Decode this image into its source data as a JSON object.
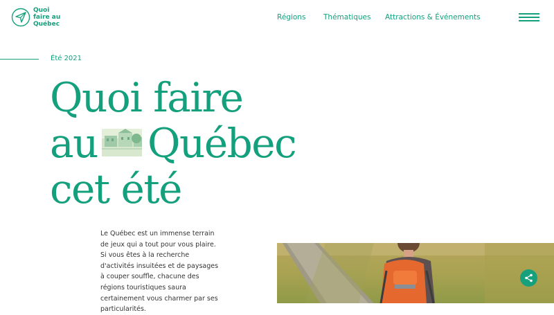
{
  "brand": {
    "lines": [
      "Quoi",
      "faire au",
      "Québec"
    ]
  },
  "nav": {
    "items": [
      "Régions",
      "Thématiques",
      "Attractions & Événements"
    ]
  },
  "icons": {
    "logo": "paper-plane-icon",
    "menu": "hamburger-menu-icon",
    "share": "share-icon"
  },
  "colors": {
    "accent": "#14a07c",
    "body_text": "#333333",
    "background": "#ffffff"
  },
  "hero": {
    "eyebrow": "Été 2021",
    "title_line1": "Quoi faire",
    "title_line2_a": "au",
    "title_line2_b": "Québec",
    "title_line3": "cet été",
    "intro": "Le Québec est un immense terrain de jeux qui a tout pour vous plaire. Si vous êtes à la recherche d'activités insuitées et de paysages à couper souffle, chacune des régions touristiques saura certainement vous charmer par ses particularités."
  }
}
